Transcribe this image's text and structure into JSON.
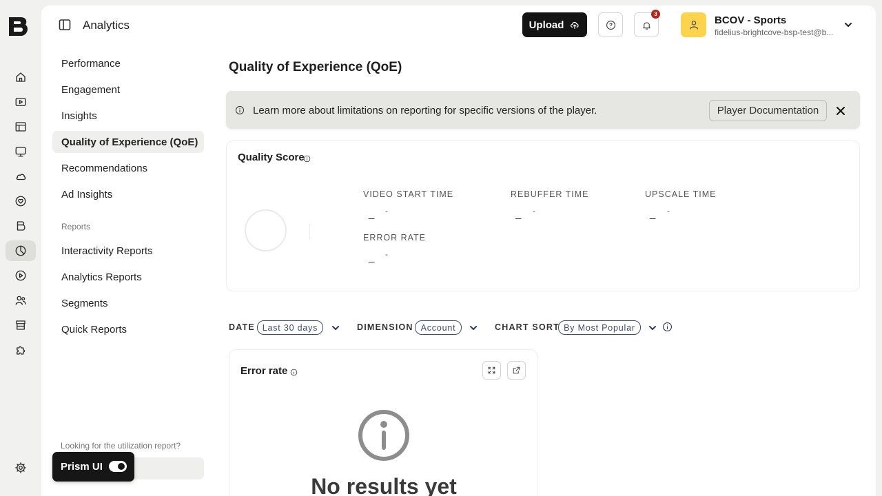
{
  "rail": {
    "items": [
      {
        "icon": "home-icon"
      },
      {
        "icon": "video-icon"
      },
      {
        "icon": "table-icon"
      },
      {
        "icon": "screen-icon"
      },
      {
        "icon": "cloud-icon"
      },
      {
        "icon": "heart-icon"
      },
      {
        "icon": "brand-icon"
      },
      {
        "icon": "analytics-icon",
        "active": true
      },
      {
        "icon": "play-icon"
      },
      {
        "icon": "users-icon"
      },
      {
        "icon": "store-icon"
      },
      {
        "icon": "puzzle-icon"
      },
      {
        "icon": "gear-icon"
      }
    ]
  },
  "header": {
    "title": "Analytics",
    "upload_label": "Upload",
    "notification_count": "3",
    "account_name": "BCOV - Sports",
    "account_email": "fidelius-brightcove-bsp-test@b..."
  },
  "subnav": {
    "items": [
      "Performance",
      "Engagement",
      "Insights",
      "Quality of Experience (QoE)",
      "Recommendations",
      "Ad Insights"
    ],
    "active_item": "Quality of Experience (QoE)",
    "reports_heading": "Reports",
    "reports_items": [
      "Interactivity Reports",
      "Analytics Reports",
      "Segments",
      "Quick Reports"
    ],
    "utilization_text": "Looking for the utilization report?",
    "prism_label": "Prism UI",
    "prism_on": true
  },
  "main": {
    "page_title": "Quality of Experience (QoE)",
    "banner": {
      "text": "Learn more about limitations on reporting for specific versions of the player.",
      "button_label": "Player Documentation"
    },
    "quality_score": {
      "title": "Quality Score",
      "metrics": [
        {
          "label": "VIDEO START TIME",
          "value": "_",
          "sub": "-"
        },
        {
          "label": "REBUFFER TIME",
          "value": "_",
          "sub": "-"
        },
        {
          "label": "UPSCALE TIME",
          "value": "_",
          "sub": "-"
        },
        {
          "label": "ERROR RATE",
          "value": "_",
          "sub": "-"
        }
      ]
    },
    "filters": {
      "date_label": "DATE",
      "date_value": "Last 30 days",
      "dimension_label": "DIMENSION",
      "dimension_value": "Account",
      "sort_label": "CHART SORT",
      "sort_value": "By Most Popular"
    },
    "error_card": {
      "title": "Error rate",
      "empty_text": "No results yet"
    }
  }
}
